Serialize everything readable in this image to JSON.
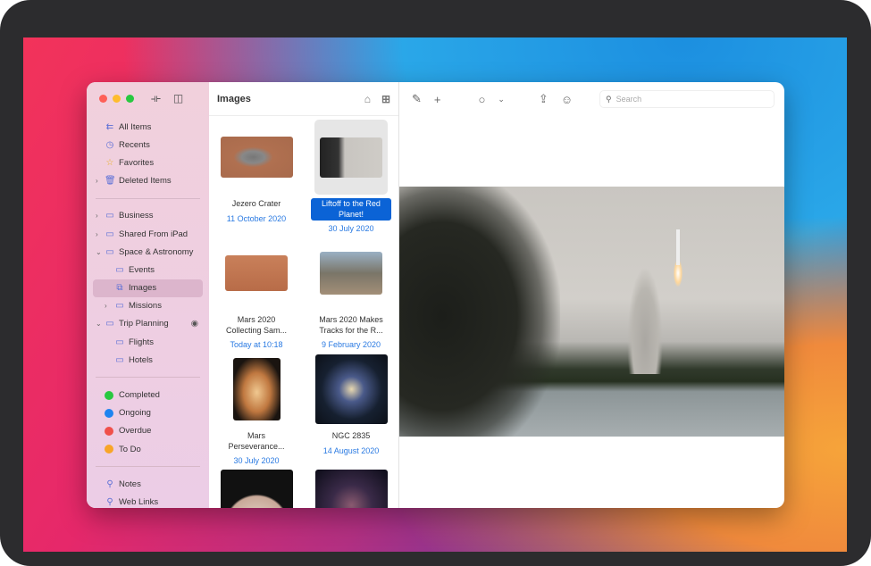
{
  "sidebar": {
    "library": [
      {
        "label": "All Items",
        "icon": "all-items-icon"
      },
      {
        "label": "Recents",
        "icon": "clock-icon"
      },
      {
        "label": "Favorites",
        "icon": "star-icon"
      },
      {
        "label": "Deleted Items",
        "icon": "trash-icon"
      }
    ],
    "folders": [
      {
        "label": "Business"
      },
      {
        "label": "Shared From iPad"
      },
      {
        "label": "Space & Astronomy"
      },
      {
        "label": "Events"
      },
      {
        "label": "Images"
      },
      {
        "label": "Missions"
      },
      {
        "label": "Trip Planning"
      },
      {
        "label": "Flights"
      },
      {
        "label": "Hotels"
      }
    ],
    "tags": [
      {
        "label": "Completed",
        "color": "#28c840"
      },
      {
        "label": "Ongoing",
        "color": "#1e84f0"
      },
      {
        "label": "Overdue",
        "color": "#f0504a"
      },
      {
        "label": "To Do",
        "color": "#f8a528"
      }
    ],
    "searches": [
      {
        "label": "Notes"
      },
      {
        "label": "Web Links"
      }
    ]
  },
  "list": {
    "title": "Images",
    "items": [
      {
        "title": "Jezero Crater",
        "date": "11 October 2020"
      },
      {
        "title": "Liftoff to the Red Planet!",
        "date": "30 July 2020"
      },
      {
        "title": "Mars 2020 Collecting Sam...",
        "date": "Today at 10:18"
      },
      {
        "title": "Mars 2020 Makes Tracks for the R...",
        "date": "9 February 2020"
      },
      {
        "title": "Mars Perseverance...",
        "date": "30 July 2020"
      },
      {
        "title": "NGC 2835",
        "date": "14 August 2020"
      }
    ]
  },
  "toolbar": {
    "search_placeholder": "Search"
  }
}
